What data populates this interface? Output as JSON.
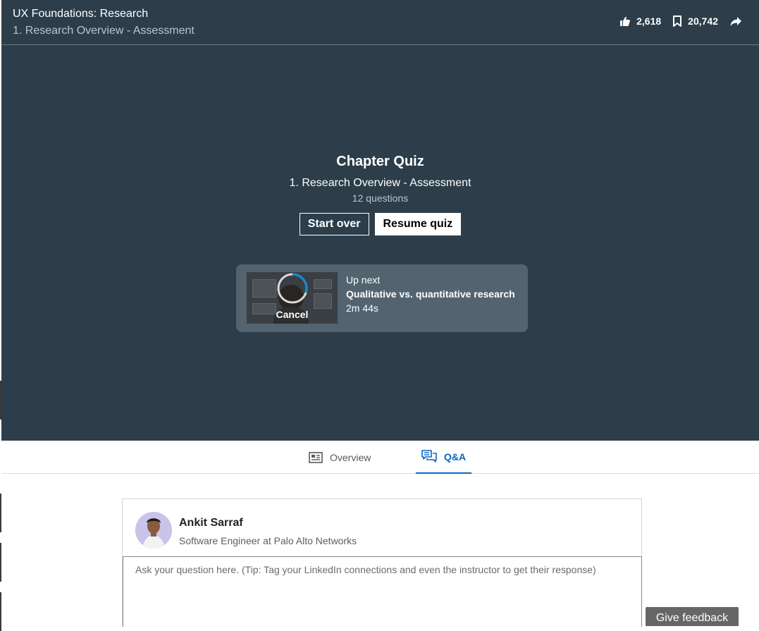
{
  "header": {
    "course_title": "UX Foundations: Research",
    "video_title": "1. Research Overview - Assessment",
    "likes": "2,618",
    "saves": "20,742"
  },
  "quiz": {
    "title": "Chapter Quiz",
    "section": "1. Research Overview - Assessment",
    "question_count": "12 questions",
    "start_over_label": "Start over",
    "resume_label": "Resume quiz"
  },
  "up_next": {
    "label": "Up next",
    "title": "Qualitative vs. quantitative research",
    "duration": "2m 44s",
    "cancel_label": "Cancel",
    "countdown_progress": 0.3
  },
  "tabs": [
    {
      "label": "Overview",
      "active": false
    },
    {
      "label": "Q&A",
      "active": true
    }
  ],
  "qa": {
    "user_name": "Ankit Sarraf",
    "user_headline": "Software Engineer at Palo Alto Networks",
    "placeholder": "Ask your question here. (Tip: Tag your LinkedIn connections and even the instructor to get their response)"
  },
  "feedback_label": "Give feedback",
  "colors": {
    "player_bg": "#2d3e4a",
    "accent": "#0a66c2",
    "up_next_bg": "#536470"
  },
  "icons": {
    "like": "thumbs-up-icon",
    "save": "bookmark-icon",
    "share": "share-arrow-icon",
    "overview": "overview-icon",
    "qa": "qa-icon"
  }
}
